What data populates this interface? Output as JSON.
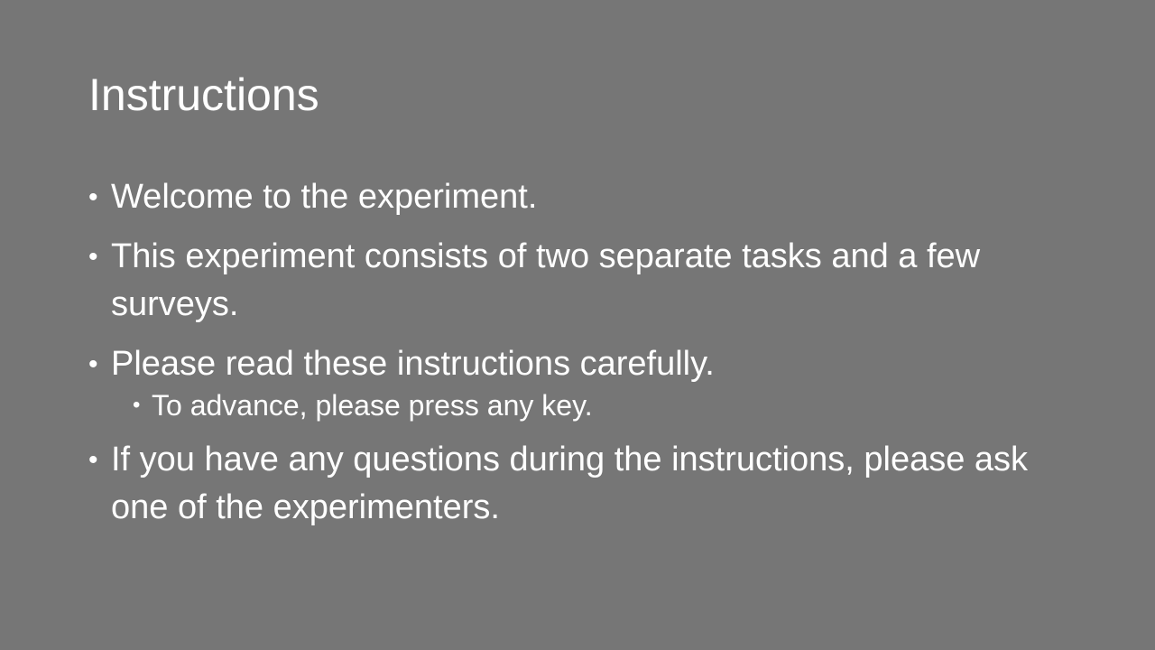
{
  "slide": {
    "title": "Instructions",
    "bullets": [
      "Welcome to the experiment.",
      "This experiment consists of two separate tasks and a few surveys.",
      "Please read these instructions carefully.",
      "If you have any questions during the instructions, please ask one of the experimenters."
    ],
    "sub_bullets": [
      "To advance, please press any key."
    ],
    "bullet_glyph": "•",
    "colors": {
      "background": "#767676",
      "text": "#ffffff"
    }
  }
}
